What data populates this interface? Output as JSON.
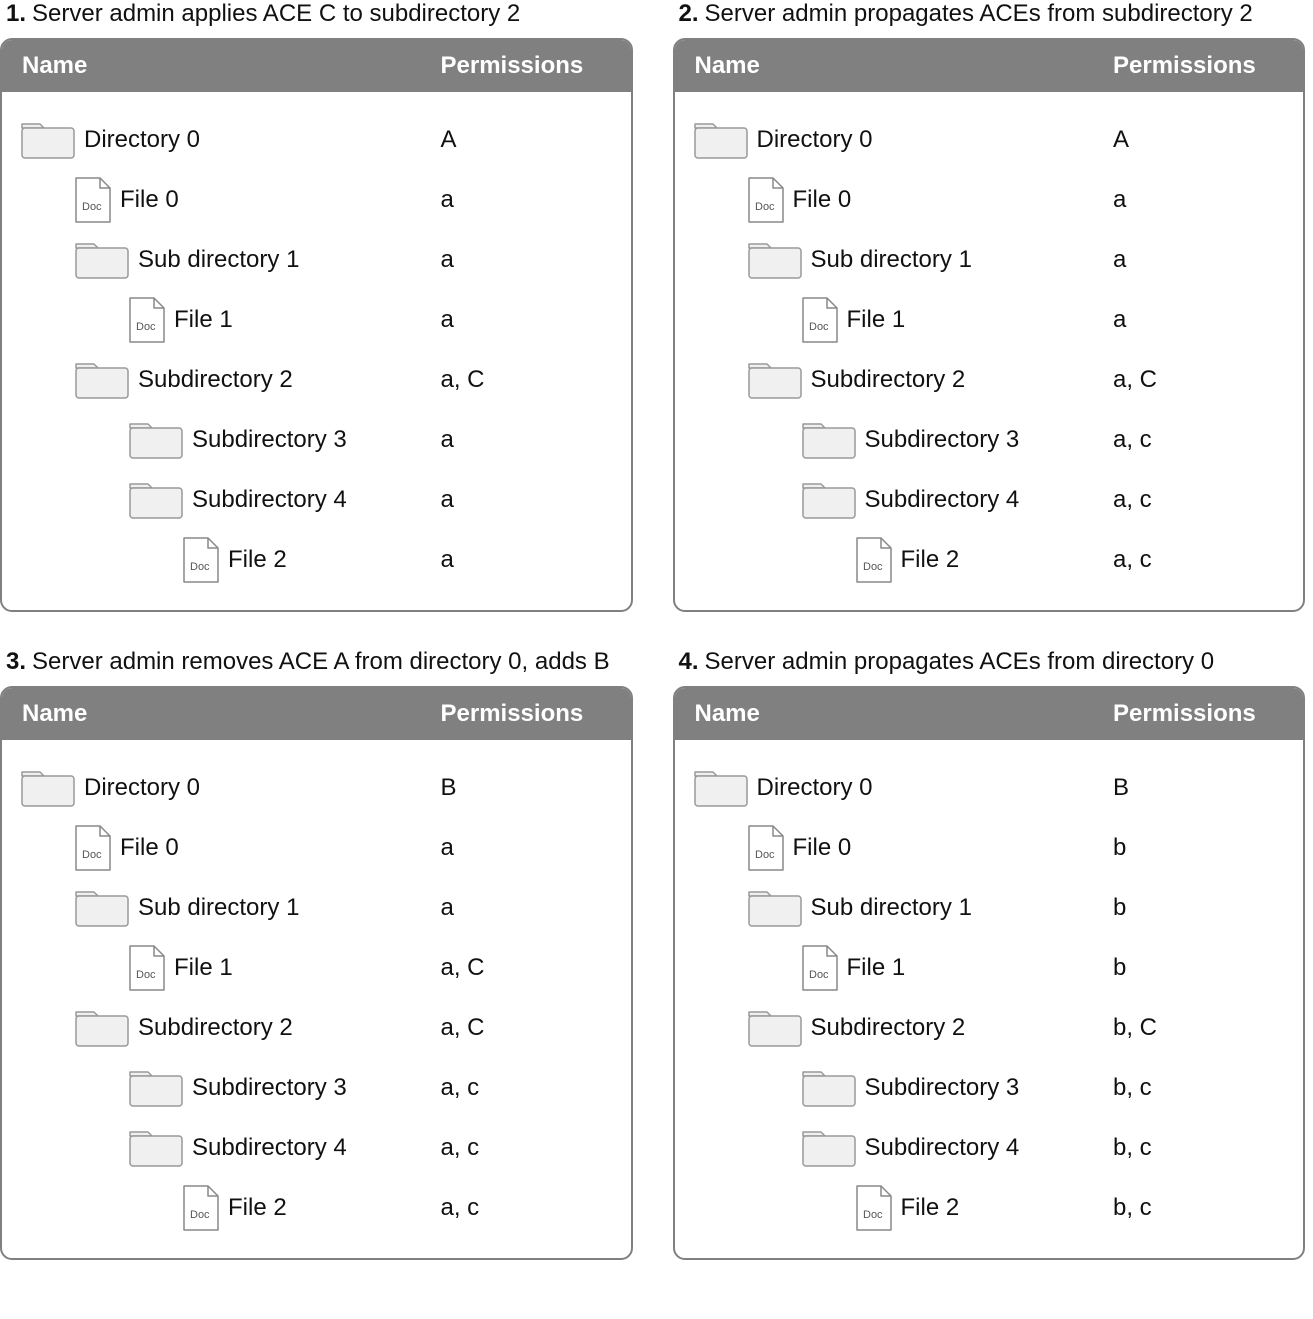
{
  "columns": {
    "name": "Name",
    "permissions": "Permissions"
  },
  "icon_doc_label": "Doc",
  "steps": [
    {
      "num": "1.",
      "caption": "Server admin applies ACE C to subdirectory 2",
      "items": [
        {
          "indent": 0,
          "icon": "folder",
          "label": "Directory 0",
          "perm": "A"
        },
        {
          "indent": 1,
          "icon": "doc",
          "label": "File 0",
          "perm": "a"
        },
        {
          "indent": 1,
          "icon": "folder",
          "label": "Sub directory 1",
          "perm": "a"
        },
        {
          "indent": 2,
          "icon": "doc",
          "label": "File 1",
          "perm": "a"
        },
        {
          "indent": 1,
          "icon": "folder",
          "label": "Subdirectory 2",
          "perm": "a, C"
        },
        {
          "indent": 2,
          "icon": "folder",
          "label": "Subdirectory 3",
          "perm": "a"
        },
        {
          "indent": 2,
          "icon": "folder",
          "label": "Subdirectory 4",
          "perm": "a"
        },
        {
          "indent": 3,
          "icon": "doc",
          "label": "File 2",
          "perm": "a"
        }
      ]
    },
    {
      "num": "2.",
      "caption": "Server admin propagates ACEs from subdirectory 2",
      "items": [
        {
          "indent": 0,
          "icon": "folder",
          "label": "Directory 0",
          "perm": "A"
        },
        {
          "indent": 1,
          "icon": "doc",
          "label": "File 0",
          "perm": "a"
        },
        {
          "indent": 1,
          "icon": "folder",
          "label": "Sub directory 1",
          "perm": "a"
        },
        {
          "indent": 2,
          "icon": "doc",
          "label": "File 1",
          "perm": "a"
        },
        {
          "indent": 1,
          "icon": "folder",
          "label": "Subdirectory 2",
          "perm": "a, C"
        },
        {
          "indent": 2,
          "icon": "folder",
          "label": "Subdirectory 3",
          "perm": "a, c"
        },
        {
          "indent": 2,
          "icon": "folder",
          "label": "Subdirectory 4",
          "perm": "a, c"
        },
        {
          "indent": 3,
          "icon": "doc",
          "label": "File 2",
          "perm": "a, c"
        }
      ]
    },
    {
      "num": "3.",
      "caption": "Server admin removes ACE A from directory 0, adds B",
      "items": [
        {
          "indent": 0,
          "icon": "folder",
          "label": "Directory 0",
          "perm": "B"
        },
        {
          "indent": 1,
          "icon": "doc",
          "label": "File 0",
          "perm": "a"
        },
        {
          "indent": 1,
          "icon": "folder",
          "label": "Sub directory 1",
          "perm": "a"
        },
        {
          "indent": 2,
          "icon": "doc",
          "label": "File 1",
          "perm": "a, C"
        },
        {
          "indent": 1,
          "icon": "folder",
          "label": "Subdirectory 2",
          "perm": "a, C"
        },
        {
          "indent": 2,
          "icon": "folder",
          "label": "Subdirectory 3",
          "perm": "a, c"
        },
        {
          "indent": 2,
          "icon": "folder",
          "label": "Subdirectory 4",
          "perm": "a, c"
        },
        {
          "indent": 3,
          "icon": "doc",
          "label": "File 2",
          "perm": "a, c"
        }
      ]
    },
    {
      "num": "4.",
      "caption": "Server admin propagates ACEs from directory 0",
      "items": [
        {
          "indent": 0,
          "icon": "folder",
          "label": "Directory 0",
          "perm": "B"
        },
        {
          "indent": 1,
          "icon": "doc",
          "label": "File 0",
          "perm": "b"
        },
        {
          "indent": 1,
          "icon": "folder",
          "label": "Sub directory 1",
          "perm": "b"
        },
        {
          "indent": 2,
          "icon": "doc",
          "label": "File 1",
          "perm": "b"
        },
        {
          "indent": 1,
          "icon": "folder",
          "label": "Subdirectory 2",
          "perm": "b, C"
        },
        {
          "indent": 2,
          "icon": "folder",
          "label": "Subdirectory 3",
          "perm": "b, c"
        },
        {
          "indent": 2,
          "icon": "folder",
          "label": "Subdirectory 4",
          "perm": "b, c"
        },
        {
          "indent": 3,
          "icon": "doc",
          "label": "File 2",
          "perm": "b, c"
        }
      ]
    }
  ]
}
